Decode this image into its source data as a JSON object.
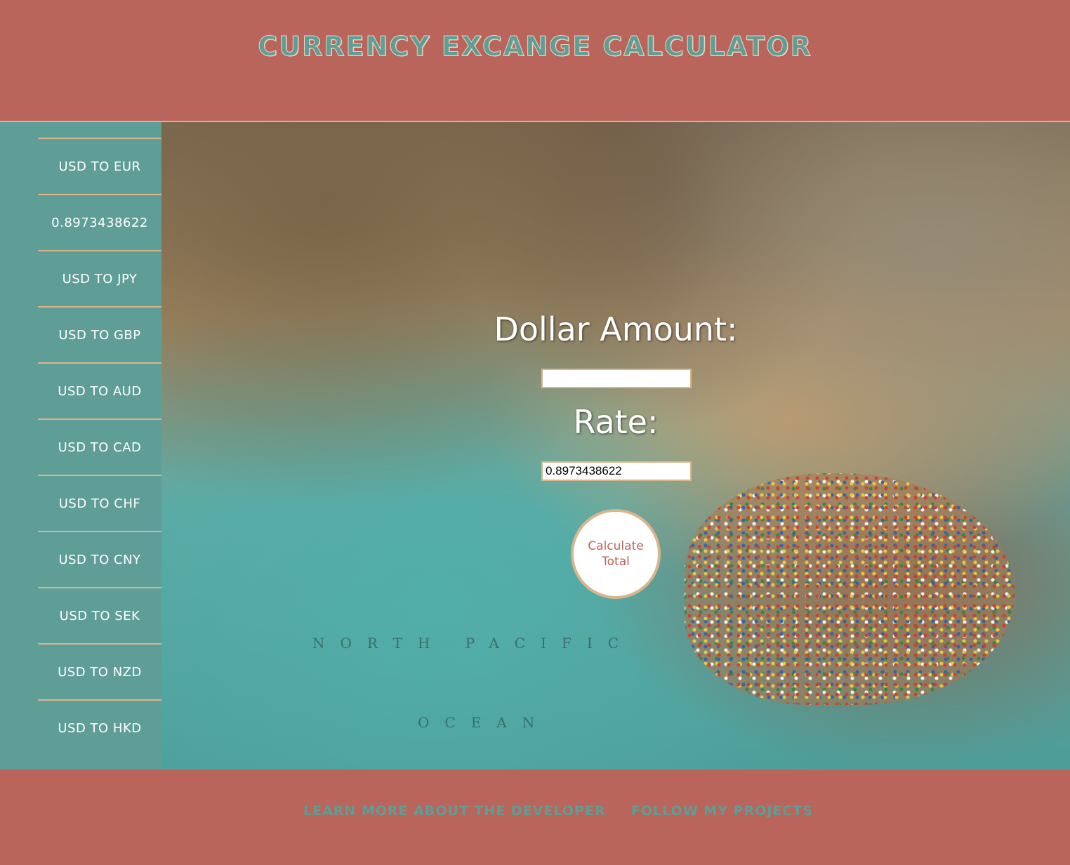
{
  "header": {
    "title": "Currency Excange Calculator"
  },
  "sidebar": {
    "items": [
      {
        "label": "USD TO EUR"
      },
      {
        "label": "0.8973438622"
      },
      {
        "label": "USD TO JPY"
      },
      {
        "label": "USD TO GBP"
      },
      {
        "label": "USD TO AUD"
      },
      {
        "label": "USD TO CAD"
      },
      {
        "label": "USD TO CHF"
      },
      {
        "label": "USD TO CNY"
      },
      {
        "label": "USD TO SEK"
      },
      {
        "label": "USD TO NZD"
      },
      {
        "label": "USD TO HKD"
      }
    ]
  },
  "form": {
    "dollar_label": "Dollar Amount:",
    "dollar_value": "",
    "rate_label": "Rate:",
    "rate_value": "0.8973438622",
    "calculate_label": "Calculate Total"
  },
  "map_labels": {
    "north_pacific": "NORTH PACIFIC",
    "ocean": "OCEAN"
  },
  "footer": {
    "developer_link": "Learn more about the developer",
    "projects_link": "Follow my projects"
  },
  "colors": {
    "header_bg": "#b9655b",
    "accent_teal": "#5f9d97",
    "border_tan": "#d9b58e"
  }
}
